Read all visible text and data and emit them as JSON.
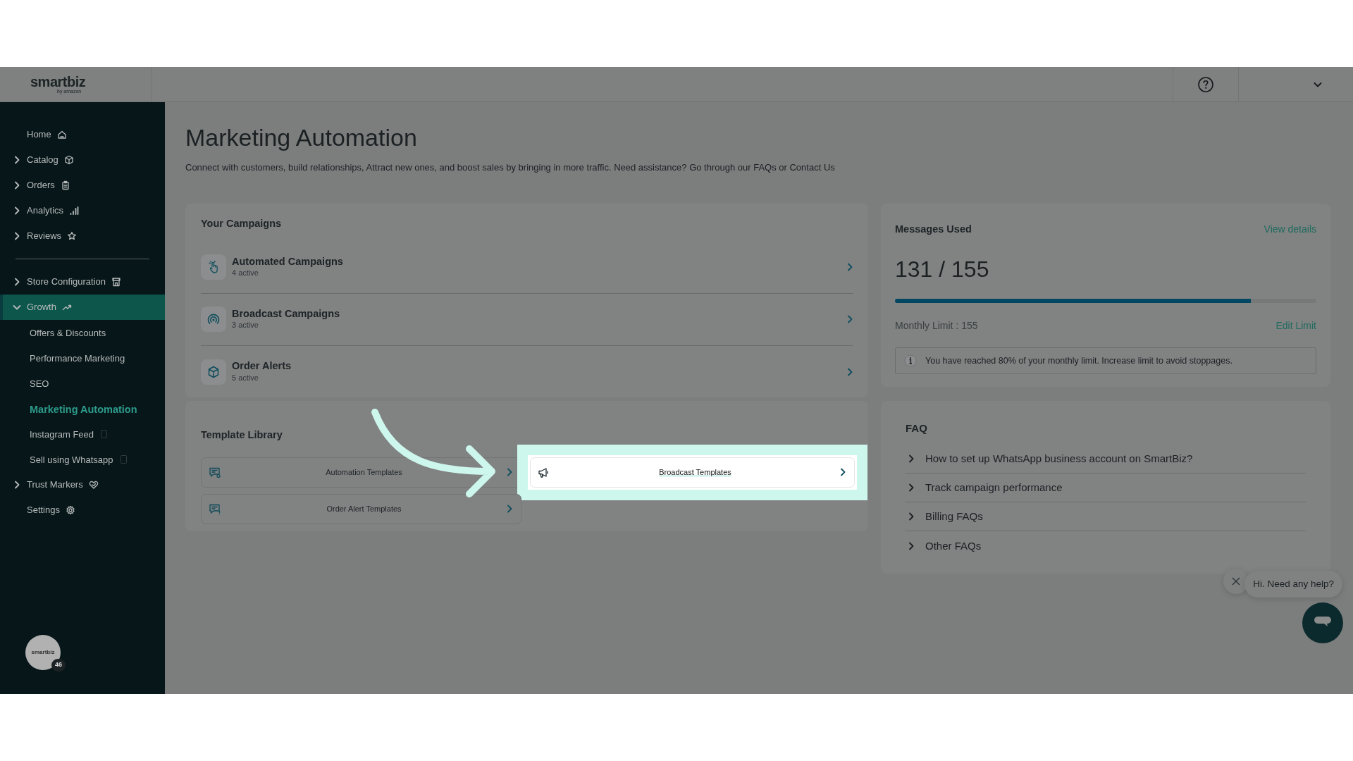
{
  "topbar": {
    "logo": "smartbiz",
    "logo_sub": "by amazon"
  },
  "sidebar": {
    "sections": [
      {
        "items": [
          {
            "label": "Home",
            "kind": "link",
            "selected": false
          },
          {
            "label": "Catalog",
            "kind": "group",
            "expanded": false,
            "selected": false
          },
          {
            "label": "Orders",
            "kind": "group",
            "expanded": false,
            "selected": false
          },
          {
            "label": "Analytics",
            "kind": "group",
            "expanded": false,
            "selected": false
          },
          {
            "label": "Reviews",
            "kind": "group",
            "expanded": false,
            "selected": false
          }
        ]
      },
      {
        "items": [
          {
            "label": "Store Configuration",
            "kind": "group",
            "expanded": false,
            "selected": false
          },
          {
            "label": "Growth",
            "kind": "group",
            "expanded": true,
            "selected": true,
            "children": [
              {
                "label": "Offers & Discounts",
                "selected": false
              },
              {
                "label": "Performance Marketing",
                "selected": false
              },
              {
                "label": "SEO",
                "selected": false
              },
              {
                "label": "Marketing Automation",
                "selected": true
              },
              {
                "label": "Instagram Feed",
                "selected": false
              },
              {
                "label": "Sell using Whatsapp",
                "selected": false
              }
            ]
          },
          {
            "label": "Trust Markers",
            "kind": "group",
            "expanded": false,
            "selected": false
          },
          {
            "label": "Settings",
            "kind": "link",
            "selected": false
          }
        ]
      }
    ],
    "account": {
      "logo": "smartbiz",
      "badge": "46"
    }
  },
  "page": {
    "title": "Marketing Automation",
    "description": "Connect with customers, build relationships, Attract new ones, and boost sales by bringing in more traffic. Need assistance? Go through our FAQs or Contact Us"
  },
  "campaigns": {
    "title": "Your Campaigns",
    "items": [
      {
        "title": "Automated Campaigns",
        "status": "4 active"
      },
      {
        "title": "Broadcast Campaigns",
        "status": "3 active"
      },
      {
        "title": "Order Alerts",
        "status": "5 active"
      }
    ]
  },
  "template_library": {
    "title": "Template Library",
    "items": [
      {
        "label": "Automation Templates",
        "highlighted": false
      },
      {
        "label": "Broadcast Templates",
        "highlighted": true
      },
      {
        "label": "Order Alert Templates",
        "highlighted": false
      }
    ]
  },
  "messages": {
    "title": "Messages Used",
    "link": "View details",
    "count": "131 / 155",
    "level": 0.845,
    "limit": "Monthly Limit : 155",
    "edit": "Edit Limit",
    "alert": "You have reached 80% of your monthly limit. Increase limit to avoid stoppages."
  },
  "faq": {
    "title": "FAQ",
    "items": [
      {
        "question": "How to set up WhatsApp business account on SmartBiz?",
        "expanded": false
      },
      {
        "question": "Track campaign performance",
        "expanded": false
      },
      {
        "question": "Billing FAQs",
        "expanded": false
      },
      {
        "question": "Other FAQs",
        "expanded": false
      }
    ]
  },
  "chat": {
    "greeting": "Hi. Need any help?"
  }
}
